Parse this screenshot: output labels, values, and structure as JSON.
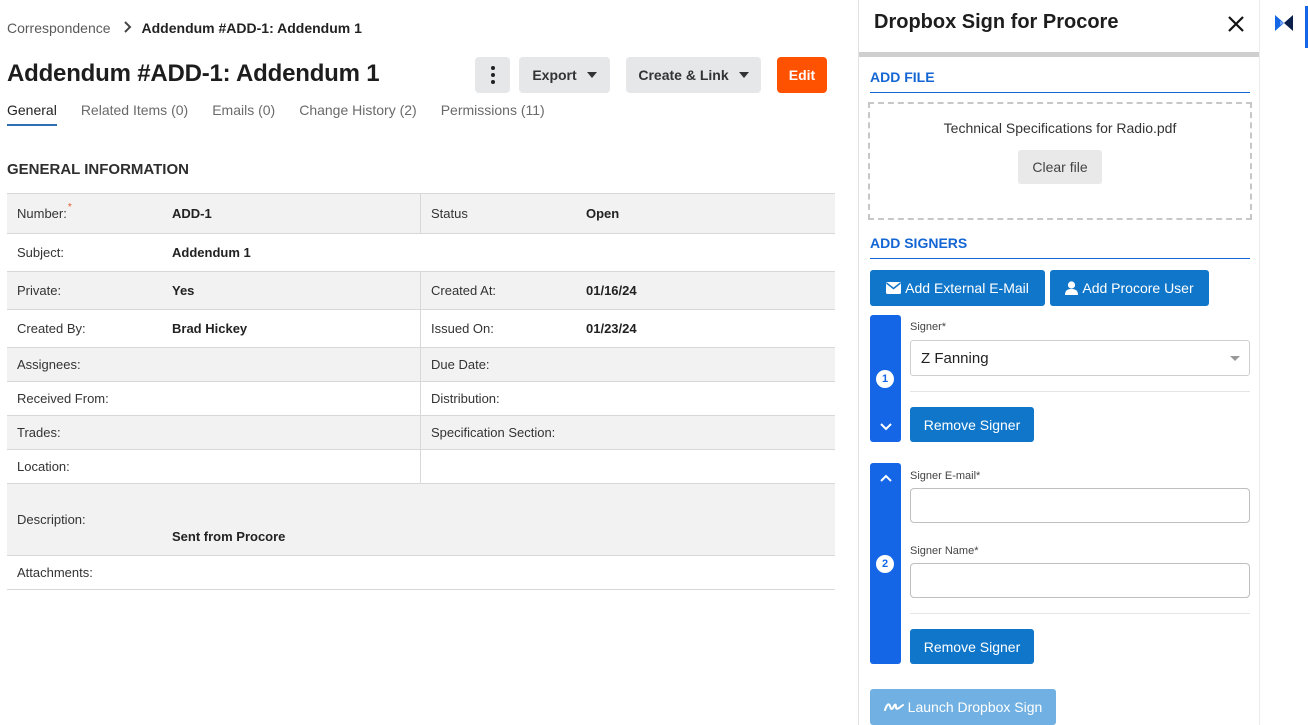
{
  "breadcrumb": {
    "parent": "Correspondence",
    "current": "Addendum #ADD-1: Addendum 1"
  },
  "page": {
    "title": "Addendum #ADD-1: Addendum 1"
  },
  "toolbar": {
    "export_label": "Export",
    "create_label": "Create & Link",
    "edit_label": "Edit"
  },
  "tabs": [
    {
      "label": "General",
      "active": true
    },
    {
      "label": "Related Items (0)"
    },
    {
      "label": "Emails (0)"
    },
    {
      "label": "Change History (2)"
    },
    {
      "label": "Permissions (11)"
    }
  ],
  "section": {
    "title": "GENERAL INFORMATION"
  },
  "info": {
    "number_label": "Number:",
    "number_value": "ADD-1",
    "status_label": "Status",
    "status_value": "Open",
    "subject_label": "Subject:",
    "subject_value": "Addendum 1",
    "private_label": "Private:",
    "private_value": "Yes",
    "created_at_label": "Created At:",
    "created_at_value": "01/16/24",
    "created_by_label": "Created By:",
    "created_by_value": "Brad Hickey",
    "issued_on_label": "Issued On:",
    "issued_on_value": "01/23/24",
    "assignees_label": "Assignees:",
    "due_date_label": "Due Date:",
    "received_from_label": "Received From:",
    "distribution_label": "Distribution:",
    "trades_label": "Trades:",
    "spec_section_label": "Specification Section:",
    "location_label": "Location:",
    "description_label": "Description:",
    "description_value": "Sent from Procore",
    "attachments_label": "Attachments:"
  },
  "panel": {
    "title": "Dropbox Sign for Procore",
    "add_file_heading": "ADD FILE",
    "file_name": "Technical Specifications for Radio.pdf",
    "clear_file_label": "Clear file",
    "add_signers_heading": "ADD SIGNERS",
    "add_external_label": "Add External E-Mail",
    "add_procore_user_label": "Add Procore User",
    "signer1": {
      "number": "1",
      "field_label": "Signer*",
      "selected": "Z Fanning",
      "remove_label": "Remove Signer"
    },
    "signer2": {
      "number": "2",
      "email_label": "Signer E-mail*",
      "email_value": "",
      "name_label": "Signer Name*",
      "name_value": "",
      "remove_label": "Remove Signer"
    },
    "launch_label": "Launch Dropbox Sign"
  },
  "colors": {
    "accent": "#1466e6",
    "edit": "#ff5200",
    "button": "#0f76c9",
    "launch_disabled": "#70b0e2"
  },
  "icons": [
    "chevron-right-icon",
    "more-vertical-icon",
    "caret-down-icon",
    "close-icon",
    "envelope-icon",
    "user-icon",
    "chevron-down-icon",
    "chevron-up-icon",
    "signature-icon",
    "dropbox-sign-logo-icon"
  ]
}
